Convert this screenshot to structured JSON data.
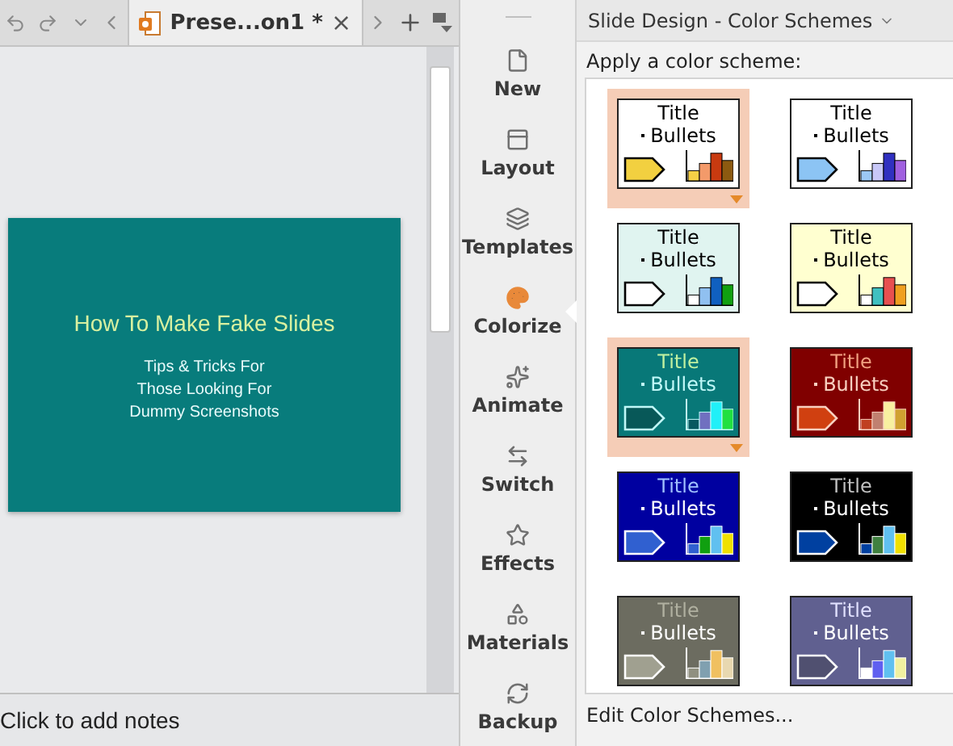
{
  "document_tab": {
    "title": "Prese...on1 *",
    "close": "×"
  },
  "slide": {
    "title": "How To Make Fake Slides",
    "subtitle_lines": [
      "Tips & Tricks For",
      "Those Looking For",
      "Dummy Screenshots"
    ]
  },
  "notes": {
    "placeholder": "Click to add notes"
  },
  "sidebar": {
    "items": [
      {
        "label": "New",
        "kind": "new",
        "selected": false
      },
      {
        "label": "Layout",
        "kind": "layout",
        "selected": false
      },
      {
        "label": "Templates",
        "kind": "templates",
        "selected": false
      },
      {
        "label": "Colorize",
        "kind": "colorize",
        "selected": true
      },
      {
        "label": "Animate",
        "kind": "animate",
        "selected": false
      },
      {
        "label": "Switch",
        "kind": "switch",
        "selected": false
      },
      {
        "label": "Effects",
        "kind": "effects",
        "selected": false
      },
      {
        "label": "Materials",
        "kind": "materials",
        "selected": false
      },
      {
        "label": "Backup",
        "kind": "backup",
        "selected": false
      }
    ]
  },
  "panel": {
    "title": "Slide Design - Color Schemes",
    "heading": "Apply a color scheme:",
    "footer": "Edit Color Schemes...",
    "schemes": [
      {
        "title": "Title",
        "bullets": "Bullets",
        "selected": true,
        "color": "#ffffff"
      },
      {
        "title": "Title",
        "bullets": "Bullets",
        "selected": false,
        "color": "#ffffff"
      },
      {
        "title": "Title",
        "bullets": "Bullets",
        "selected": false,
        "color": "#e0f4f0"
      },
      {
        "title": "Title",
        "bullets": "Bullets",
        "selected": false,
        "color": "#ffffd0"
      },
      {
        "title": "Title",
        "bullets": "Bullets",
        "selected": true,
        "color": "#087878"
      },
      {
        "title": "Title",
        "bullets": "Bullets",
        "selected": false,
        "color": "#800000"
      },
      {
        "title": "Title",
        "bullets": "Bullets",
        "selected": false,
        "color": "#0000a0"
      },
      {
        "title": "Title",
        "bullets": "Bullets",
        "selected": false,
        "color": "#000000"
      },
      {
        "title": "Title",
        "bullets": "Bullets",
        "selected": false,
        "color": "#6c6c60"
      },
      {
        "title": "Title",
        "bullets": "Bullets",
        "selected": false,
        "color": "#606090"
      }
    ]
  }
}
